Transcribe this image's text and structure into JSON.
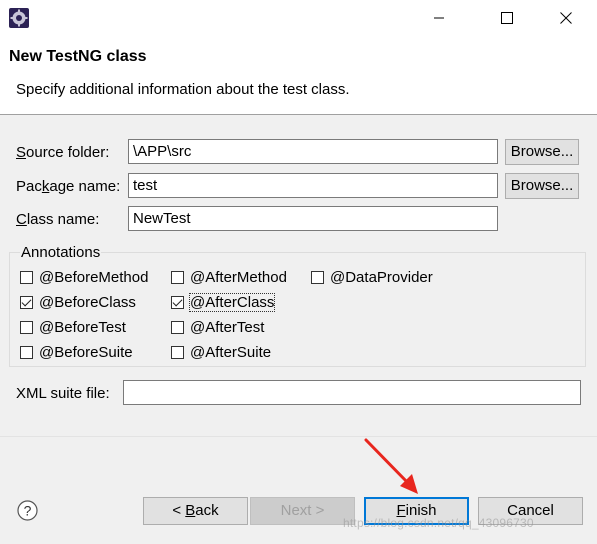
{
  "window": {
    "icon": "eclipse-icon",
    "controls": [
      "minimize-icon",
      "maximize-icon",
      "close-icon"
    ]
  },
  "header": {
    "title": "New TestNG class",
    "description": "Specify additional information about the test class."
  },
  "form": {
    "source_folder": {
      "label_pre": "",
      "label_ul": "S",
      "label_post": "ource folder:",
      "value": "\\APP\\src",
      "browse": "Browse..."
    },
    "package_name": {
      "label_pre": "Pac",
      "label_ul": "k",
      "label_post": "age name:",
      "value": "test",
      "browse": "Browse..."
    },
    "class_name": {
      "label_pre": "",
      "label_ul": "C",
      "label_post": "lass name:",
      "value": "NewTest"
    },
    "xml_suite": {
      "label": "XML suite file:",
      "value": ""
    }
  },
  "annotations": {
    "label": "Annotations",
    "items": [
      {
        "label": "@BeforeMethod",
        "checked": false
      },
      {
        "label": "@AfterMethod",
        "checked": false
      },
      {
        "label": "@DataProvider",
        "checked": false
      },
      {
        "label": "@BeforeClass",
        "checked": true
      },
      {
        "label": "@AfterClass",
        "checked": true
      },
      {
        "label": "@BeforeTest",
        "checked": false
      },
      {
        "label": "@AfterTest",
        "checked": false
      },
      {
        "label": "@BeforeSuite",
        "checked": false
      },
      {
        "label": "@AfterSuite",
        "checked": false
      }
    ]
  },
  "buttons": {
    "help": "help-icon",
    "back_pre": "< ",
    "back_ul": "B",
    "back_post": "ack",
    "next": "Next >",
    "finish_pre": "",
    "finish_ul": "F",
    "finish_post": "inish",
    "cancel": "Cancel"
  },
  "watermark": "https://blog.csdn.net/qq_43096730",
  "colors": {
    "accent": "#0078d7",
    "arrow": "#e8261e"
  }
}
